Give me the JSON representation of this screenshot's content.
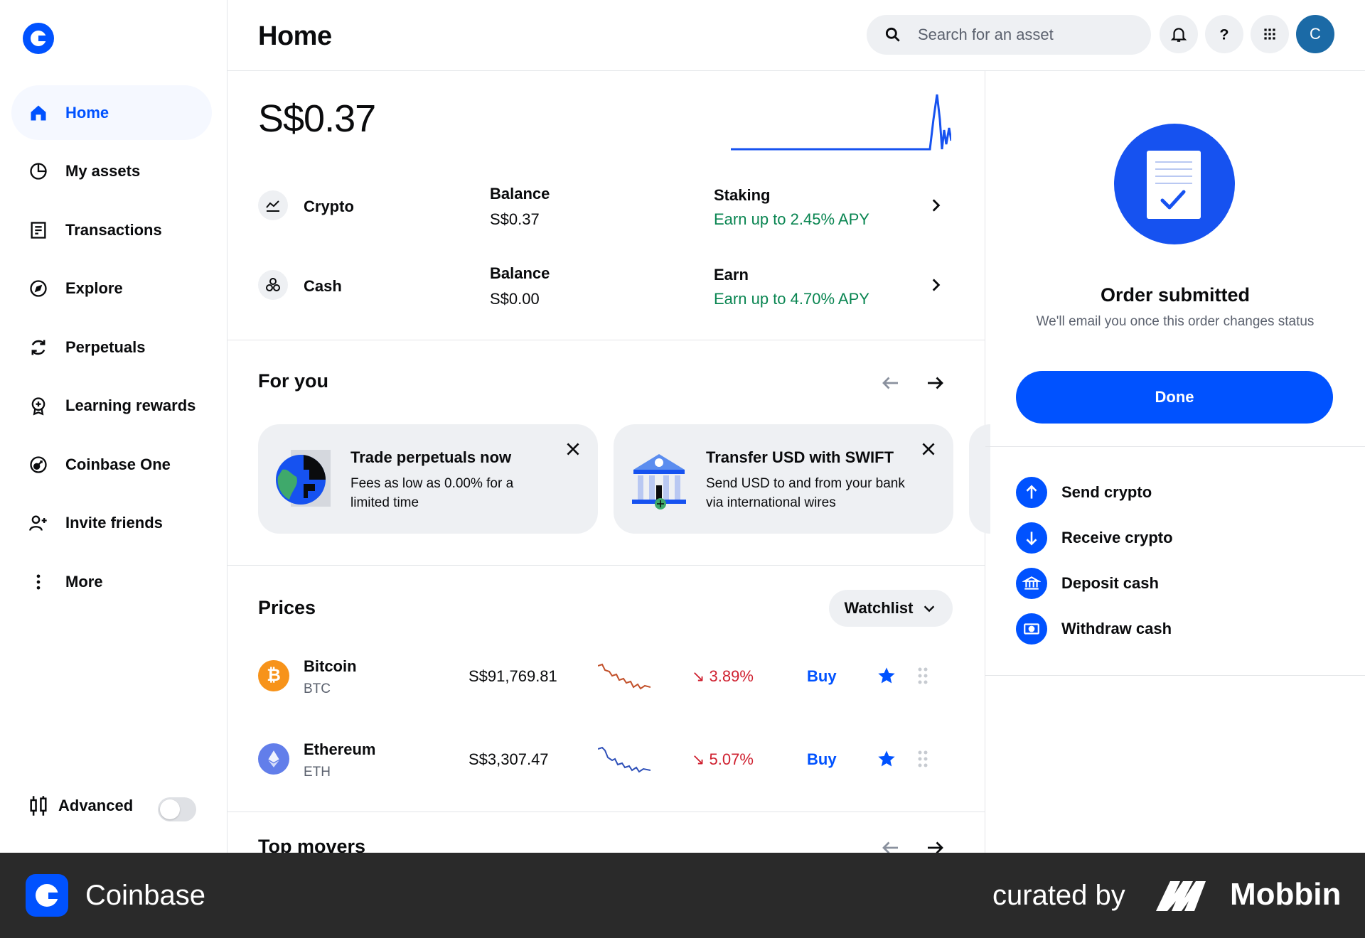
{
  "app": {
    "name": "Coinbase"
  },
  "sidebar": {
    "items": [
      {
        "label": "Home",
        "icon": "home-icon"
      },
      {
        "label": "My assets",
        "icon": "pie-chart-icon"
      },
      {
        "label": "Transactions",
        "icon": "receipt-icon"
      },
      {
        "label": "Explore",
        "icon": "compass-icon"
      },
      {
        "label": "Perpetuals",
        "icon": "refresh-icon"
      },
      {
        "label": "Learning rewards",
        "icon": "badge-icon"
      },
      {
        "label": "Coinbase One",
        "icon": "coinbase-one-icon"
      },
      {
        "label": "Invite friends",
        "icon": "add-user-icon"
      },
      {
        "label": "More",
        "icon": "more-vertical-icon"
      }
    ],
    "advanced_label": "Advanced",
    "advanced_enabled": false
  },
  "header": {
    "title": "Home",
    "search_placeholder": "Search for an asset",
    "avatar_initial": "C"
  },
  "portfolio": {
    "total": "S$0.37",
    "rows": [
      {
        "name": "Crypto",
        "balance_label": "Balance",
        "balance": "S$0.37",
        "promo_label": "Staking",
        "promo_value": "Earn up to 2.45% APY"
      },
      {
        "name": "Cash",
        "balance_label": "Balance",
        "balance": "S$0.00",
        "promo_label": "Earn",
        "promo_value": "Earn up to 4.70% APY"
      }
    ]
  },
  "for_you": {
    "title": "For you",
    "cards": [
      {
        "title": "Trade perpetuals now",
        "desc": "Fees as low as 0.00% for a limited time"
      },
      {
        "title": "Transfer USD with SWIFT",
        "desc": "Send USD to and from your bank via international wires"
      }
    ]
  },
  "prices": {
    "title": "Prices",
    "filter": "Watchlist",
    "rows": [
      {
        "name": "Bitcoin",
        "symbol": "BTC",
        "price": "S$91,769.81",
        "change": "↘ 3.89%",
        "buy": "Buy",
        "color": "#f7931a",
        "spark_color": "#c2512b"
      },
      {
        "name": "Ethereum",
        "symbol": "ETH",
        "price": "S$3,307.47",
        "change": "↘ 5.07%",
        "buy": "Buy",
        "color": "#627eea",
        "spark_color": "#2d4fb8"
      }
    ]
  },
  "top_movers": {
    "title": "Top movers"
  },
  "order": {
    "title": "Order submitted",
    "subtitle": "We'll email you once this order changes status",
    "done_label": "Done"
  },
  "actions": [
    {
      "label": "Send crypto",
      "icon": "arrow-up-icon"
    },
    {
      "label": "Receive crypto",
      "icon": "arrow-down-icon"
    },
    {
      "label": "Deposit cash",
      "icon": "bank-icon"
    },
    {
      "label": "Withdraw cash",
      "icon": "cash-icon"
    }
  ],
  "footer": {
    "brand": "Coinbase",
    "curated": "curated by",
    "curator": "Mobbin"
  },
  "colors": {
    "accent": "#0052ff",
    "positive": "#098551",
    "negative": "#cf202f"
  }
}
